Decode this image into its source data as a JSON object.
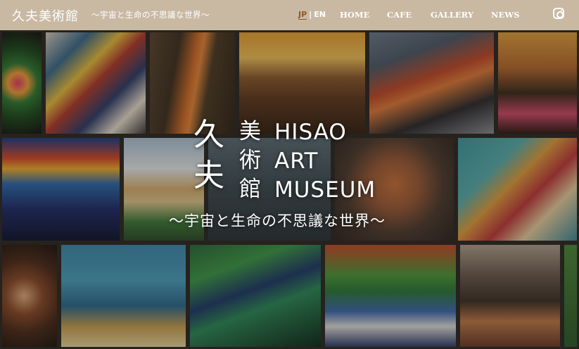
{
  "header": {
    "logo": "久夫美術館",
    "tagline": "〜宇宙と生命の不思議な世界〜",
    "lang": {
      "jp": "JP",
      "separator": "|",
      "en": "EN"
    },
    "nav": [
      {
        "label": "HOME"
      },
      {
        "label": "CAFE"
      },
      {
        "label": "GALLERY"
      },
      {
        "label": "NEWS"
      }
    ],
    "social_icon": "instagram-icon"
  },
  "hero": {
    "kanji_large": [
      "久",
      "夫"
    ],
    "kanji_small": [
      "美",
      "術",
      "館"
    ],
    "title_en": [
      "HISAO",
      "ART",
      "MUSEUM"
    ],
    "subtitle": "〜宇宙と生命の不思議な世界〜"
  },
  "colors": {
    "header_bg": "#c9b9a3",
    "active_lang": "#8a5a2b",
    "text": "#ffffff"
  }
}
